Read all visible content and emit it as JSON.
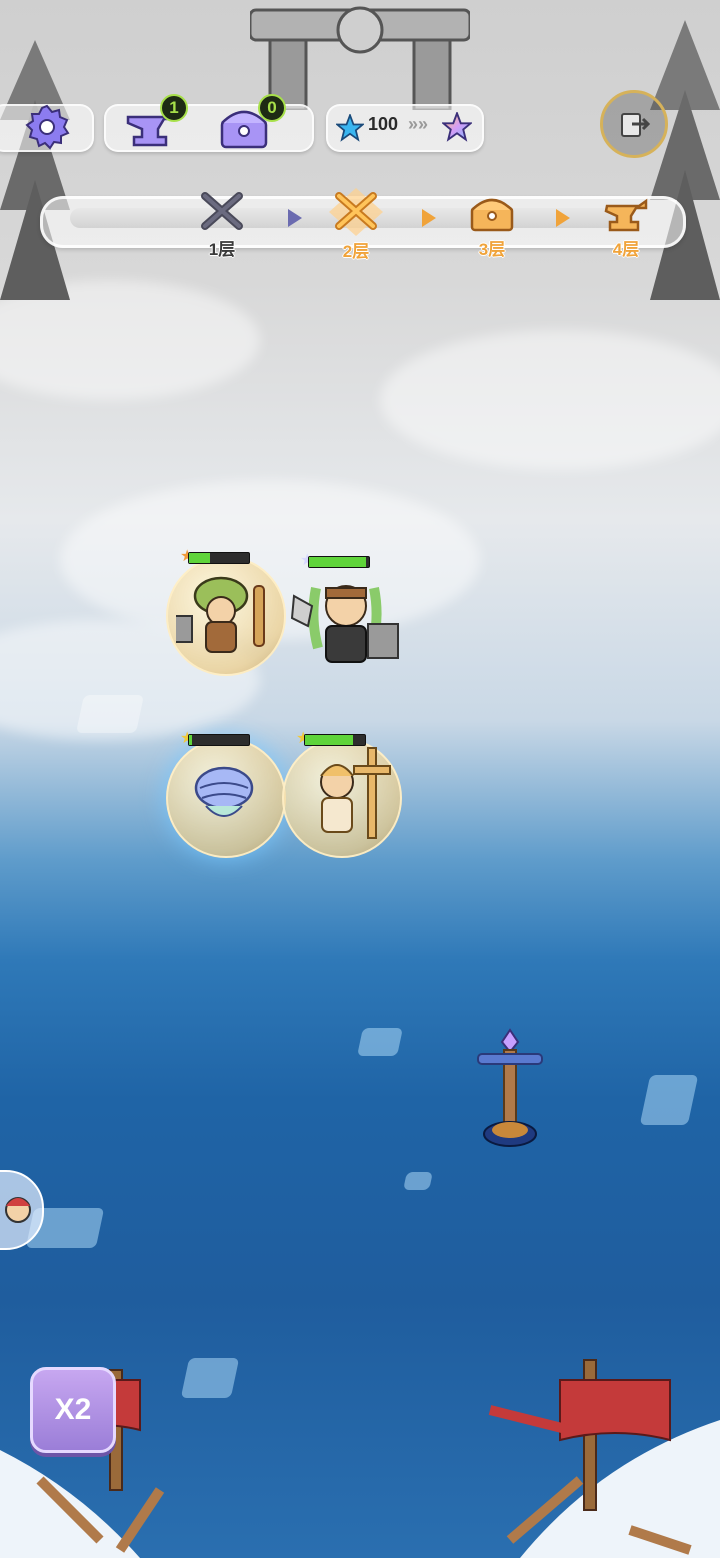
{
  "hud": {
    "settings": {
      "icon": "gear-icon",
      "color": "#8c7cf0"
    },
    "anvil": {
      "icon": "anvil-icon",
      "count": "1"
    },
    "chest": {
      "icon": "treasure-chest-icon",
      "count": "0"
    },
    "stars": {
      "icon": "blue-star-icon",
      "value": "100",
      "next_icon": "rainbow-star-icon"
    },
    "exit": {
      "icon": "exit-door-icon"
    }
  },
  "floors": [
    {
      "label": "1层",
      "icon": "crossed-swords-icon",
      "state": "done",
      "color": "#3a3a3a"
    },
    {
      "label": "2层",
      "icon": "crossed-swords-icon",
      "state": "current",
      "color": "#f0a33a"
    },
    {
      "label": "3层",
      "icon": "treasure-chest-icon",
      "state": "upcoming",
      "color": "#f0a33a"
    },
    {
      "label": "4层",
      "icon": "anvil-icon",
      "state": "upcoming",
      "color": "#f0a33a"
    }
  ],
  "heroes": [
    {
      "name": "mushroom-hat-warrior",
      "star_color": "#f09b3a",
      "hp": 0.35
    },
    {
      "name": "green-haired-axe-warrior",
      "star_color": "#d8d8ff",
      "hp": 0.95
    },
    {
      "name": "ice-mage",
      "star_color": "#f0c93a",
      "hp": 0.05
    },
    {
      "name": "priest-with-cross",
      "star_color": "#f0c93a",
      "hp": 0.8
    }
  ],
  "speed_button": {
    "label": "X2"
  },
  "colors": {
    "accent": "#f0a33a",
    "hp": "#5fd43a",
    "badge": "#a7e04a"
  }
}
